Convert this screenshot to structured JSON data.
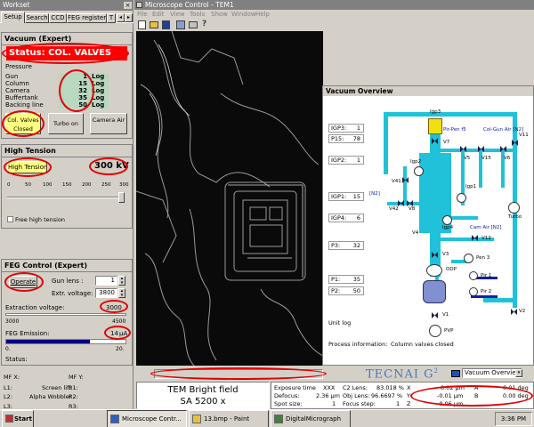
{
  "workset_title": "Workset",
  "tabs": [
    "Setup",
    "Search",
    "CCD",
    "FEG register",
    "T"
  ],
  "vacuum": {
    "header": "Vacuum (Expert)",
    "status": "Status:  COL. VALVES",
    "pressure_label": "Pressure",
    "rows": [
      {
        "name": "Gun",
        "value": "1",
        "unit": "Log"
      },
      {
        "name": "Column",
        "value": "15",
        "unit": "Log"
      },
      {
        "name": "Camera",
        "value": "32",
        "unit": "Log"
      },
      {
        "name": "Buffertank",
        "value": "35",
        "unit": "Log"
      },
      {
        "name": "Backing line",
        "value": "50",
        "unit": "Log"
      }
    ],
    "btn_col_valves": "Col. Valves Closed",
    "btn_turbo": "Turbo on",
    "btn_camera": "Camera Air"
  },
  "ht": {
    "header": "High Tension",
    "button": "High Tension",
    "value": "300 kV",
    "ticks": [
      "0",
      "50",
      "100",
      "150",
      "200",
      "250",
      "300"
    ],
    "free_label": "Free high tension"
  },
  "feg": {
    "header": "FEG Control (Expert)",
    "operate": "Operate",
    "gun_lens_label": "Gun lens :",
    "gun_lens": "1",
    "extr_label": "Extr. voltage:",
    "extr_value": "3800",
    "extraction_label": "Extraction voltage:",
    "extraction_value": "3000",
    "scale_min": "3000",
    "scale_max": "4500",
    "emission_label": "FEG Emission:",
    "emission_value": "14",
    "emission_unit": "µA",
    "em_min": "0.",
    "em_max": "20.",
    "status_label": "Status:"
  },
  "bottom_left": {
    "mfx": "MF X:",
    "mfy": "MF Y:",
    "l1": "L1:",
    "r1": "R1:",
    "screen_lift": "Screen lift",
    "l2": "L2:",
    "r2": "R2:",
    "alpha_wobbler": "Alpha Wobbler",
    "l3": "L3:",
    "r3": "R3:"
  },
  "main_window": {
    "title": "Microscope Control - TEM1",
    "menu": [
      "File",
      "Edit",
      "View",
      "Tools",
      "Show",
      "Window",
      "Help"
    ]
  },
  "vacuum_overview": {
    "title": "Vacuum Overview",
    "left_values": [
      {
        "label": "IGP3:",
        "value": "1"
      },
      {
        "label": "P15:",
        "value": "78"
      },
      {
        "label": "IGP2:",
        "value": "1"
      },
      {
        "label": "IGP1:",
        "value": "15"
      },
      {
        "label": "IGP4:",
        "value": "6"
      },
      {
        "label": "P3:",
        "value": "32"
      },
      {
        "label": "P1:",
        "value": "35"
      },
      {
        "label": "P2:",
        "value": "50"
      }
    ],
    "labels": {
      "igp3": "Igp3",
      "pirpen": "Pir-Pen f5",
      "colgun": "Col-Gun Air [N2]",
      "v7": "V7",
      "v5": "V5",
      "v15": "V15",
      "v6": "V6",
      "v11": "V11",
      "v41": "V41",
      "igp2": "Igp2",
      "n2": "[N2]",
      "v42": "V42",
      "v8": "V8",
      "igp1": "Igp1",
      "turbo": "Turbo",
      "v4": "V4",
      "igp4": "Igp4",
      "camair": "Cam Air [N2]",
      "v12": "V12",
      "v3": "V3",
      "penpen3": "Pen 3",
      "odp": "ODP",
      "pir1": "Pir 1",
      "pir2": "Pir 2",
      "v1": "V1",
      "v2": "V2",
      "pvp": "PVP"
    },
    "unit": "Unit log",
    "process_label": "Process information:",
    "process_value": "Column valves closed"
  },
  "brand": "TECNAI G",
  "brand_sup": "2",
  "overview_select": "Vacuum Overview",
  "mode": {
    "line1": "TEM Bright field",
    "line2": "SA 5200 x"
  },
  "stats": {
    "exposure_time": "Exposure time",
    "xxx": "XXX",
    "c2lens": "C2 Lens:",
    "c2val": "83.018 %",
    "defocus": "Defocus:",
    "defval": "2.36 µm",
    "objlens": "Obj Lens:",
    "objval": "96.6697 %",
    "spot": "Spot size:",
    "spotval": "1",
    "focus": "Focus step:",
    "focusval": "1"
  },
  "coords": [
    {
      "axis": "X",
      "val": "0.02 µm",
      "l": "A",
      "r": "0.01 deg"
    },
    {
      "axis": "Y",
      "val": "-0.01 µm",
      "l": "B",
      "r": "0.00 deg"
    },
    {
      "axis": "Z",
      "val": "-0.06 µm",
      "l": "",
      "r": ""
    }
  ],
  "taskbar": {
    "start": "Start",
    "items": [
      "Microscope Contr...",
      "13.bmp - Paint",
      "DigitalMicrograph"
    ],
    "clock": "3:36 PM"
  }
}
